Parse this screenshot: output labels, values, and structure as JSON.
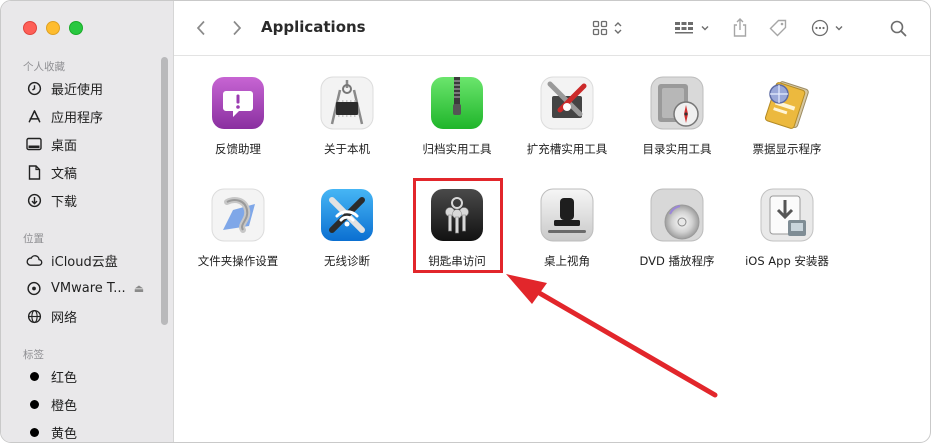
{
  "window": {
    "title": "Applications"
  },
  "sidebar": {
    "favorites_title": "个人收藏",
    "favorites": [
      {
        "label": "最近使用",
        "icon": "clock-icon"
      },
      {
        "label": "应用程序",
        "icon": "apps-icon"
      },
      {
        "label": "桌面",
        "icon": "desktop-icon"
      },
      {
        "label": "文稿",
        "icon": "document-icon"
      },
      {
        "label": "下载",
        "icon": "download-icon"
      }
    ],
    "locations_title": "位置",
    "locations": [
      {
        "label": "iCloud云盘",
        "icon": "cloud-icon"
      },
      {
        "label": "VMware T...",
        "icon": "drive-icon"
      },
      {
        "label": "网络",
        "icon": "network-icon"
      }
    ],
    "tags_title": "标签",
    "tags": [
      {
        "label": "红色",
        "color": "#000000"
      },
      {
        "label": "橙色",
        "color": "#000000"
      },
      {
        "label": "黄色",
        "color": "#000000"
      }
    ]
  },
  "apps": [
    {
      "label": "反馈助理",
      "icon": "feedback-assistant-icon"
    },
    {
      "label": "关于本机",
      "icon": "system-information-icon"
    },
    {
      "label": "归档实用工具",
      "icon": "archive-utility-icon"
    },
    {
      "label": "扩充槽实用工具",
      "icon": "expansion-slot-utility-icon"
    },
    {
      "label": "目录实用工具",
      "icon": "directory-utility-icon"
    },
    {
      "label": "票据显示程序",
      "icon": "ticket-viewer-icon"
    },
    {
      "label": "文件夹操作设置",
      "icon": "folder-actions-setup-icon"
    },
    {
      "label": "无线诊断",
      "icon": "wireless-diagnostics-icon"
    },
    {
      "label": "钥匙串访问",
      "icon": "keychain-access-icon"
    },
    {
      "label": "桌上视角",
      "icon": "desk-view-icon"
    },
    {
      "label": "DVD 播放程序",
      "icon": "dvd-player-icon"
    },
    {
      "label": "iOS App 安装器",
      "icon": "ios-app-installer-icon"
    }
  ],
  "colors": {
    "highlight": "#e2262b",
    "sidebar_bg": "#e9e8ea"
  }
}
